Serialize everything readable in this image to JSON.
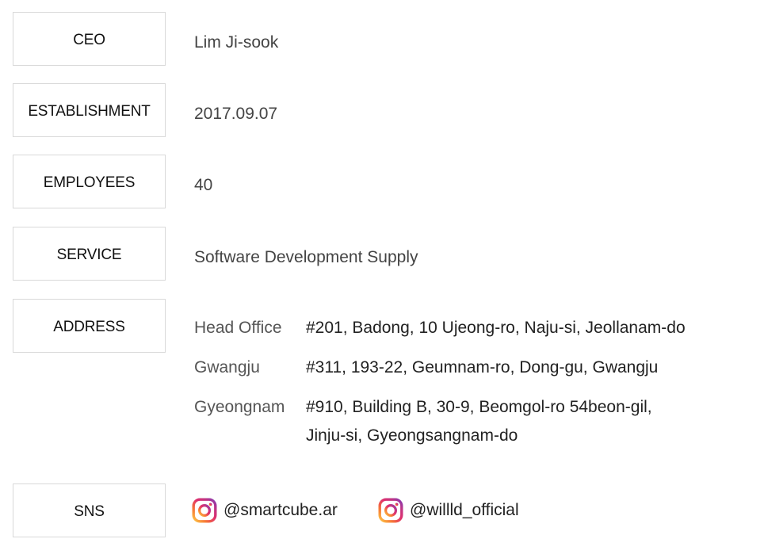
{
  "info_rows": [
    {
      "label": "CEO",
      "value": "Lim Ji-sook"
    },
    {
      "label": "ESTABLISHMENT",
      "value": "2017.09.07"
    },
    {
      "label": "EMPLOYEES",
      "value": "40"
    },
    {
      "label": "SERVICE",
      "value": "Software Development Supply"
    }
  ],
  "address": {
    "label": "ADDRESS",
    "items": [
      {
        "name": "Head Office",
        "lines": [
          "#201, Badong, 10 Ujeong-ro, Naju-si, Jeollanam-do"
        ]
      },
      {
        "name": "Gwangju",
        "lines": [
          "#311, 193-22, Geumnam-ro, Dong-gu, Gwangju"
        ]
      },
      {
        "name": "Gyeongnam",
        "lines": [
          "#910, Building B, 30-9, Beomgol-ro 54beon-gil,",
          "Jinju-si, Gyeongsangnam-do"
        ]
      }
    ]
  },
  "sns": {
    "label": "SNS",
    "accounts": [
      {
        "icon": "instagram-icon",
        "handle": "@smartcube.ar"
      },
      {
        "icon": "instagram-icon",
        "handle": "@willld_official"
      }
    ]
  },
  "colors": {
    "border": "#d9d9d9",
    "label_text": "#111111",
    "value_text": "#444444",
    "address_name_text": "#555555",
    "address_text": "#222222",
    "sns_text": "#222222",
    "instagram_gradient": [
      "#fdc745",
      "#f77737",
      "#e1306c",
      "#c13584",
      "#833ab4"
    ]
  }
}
